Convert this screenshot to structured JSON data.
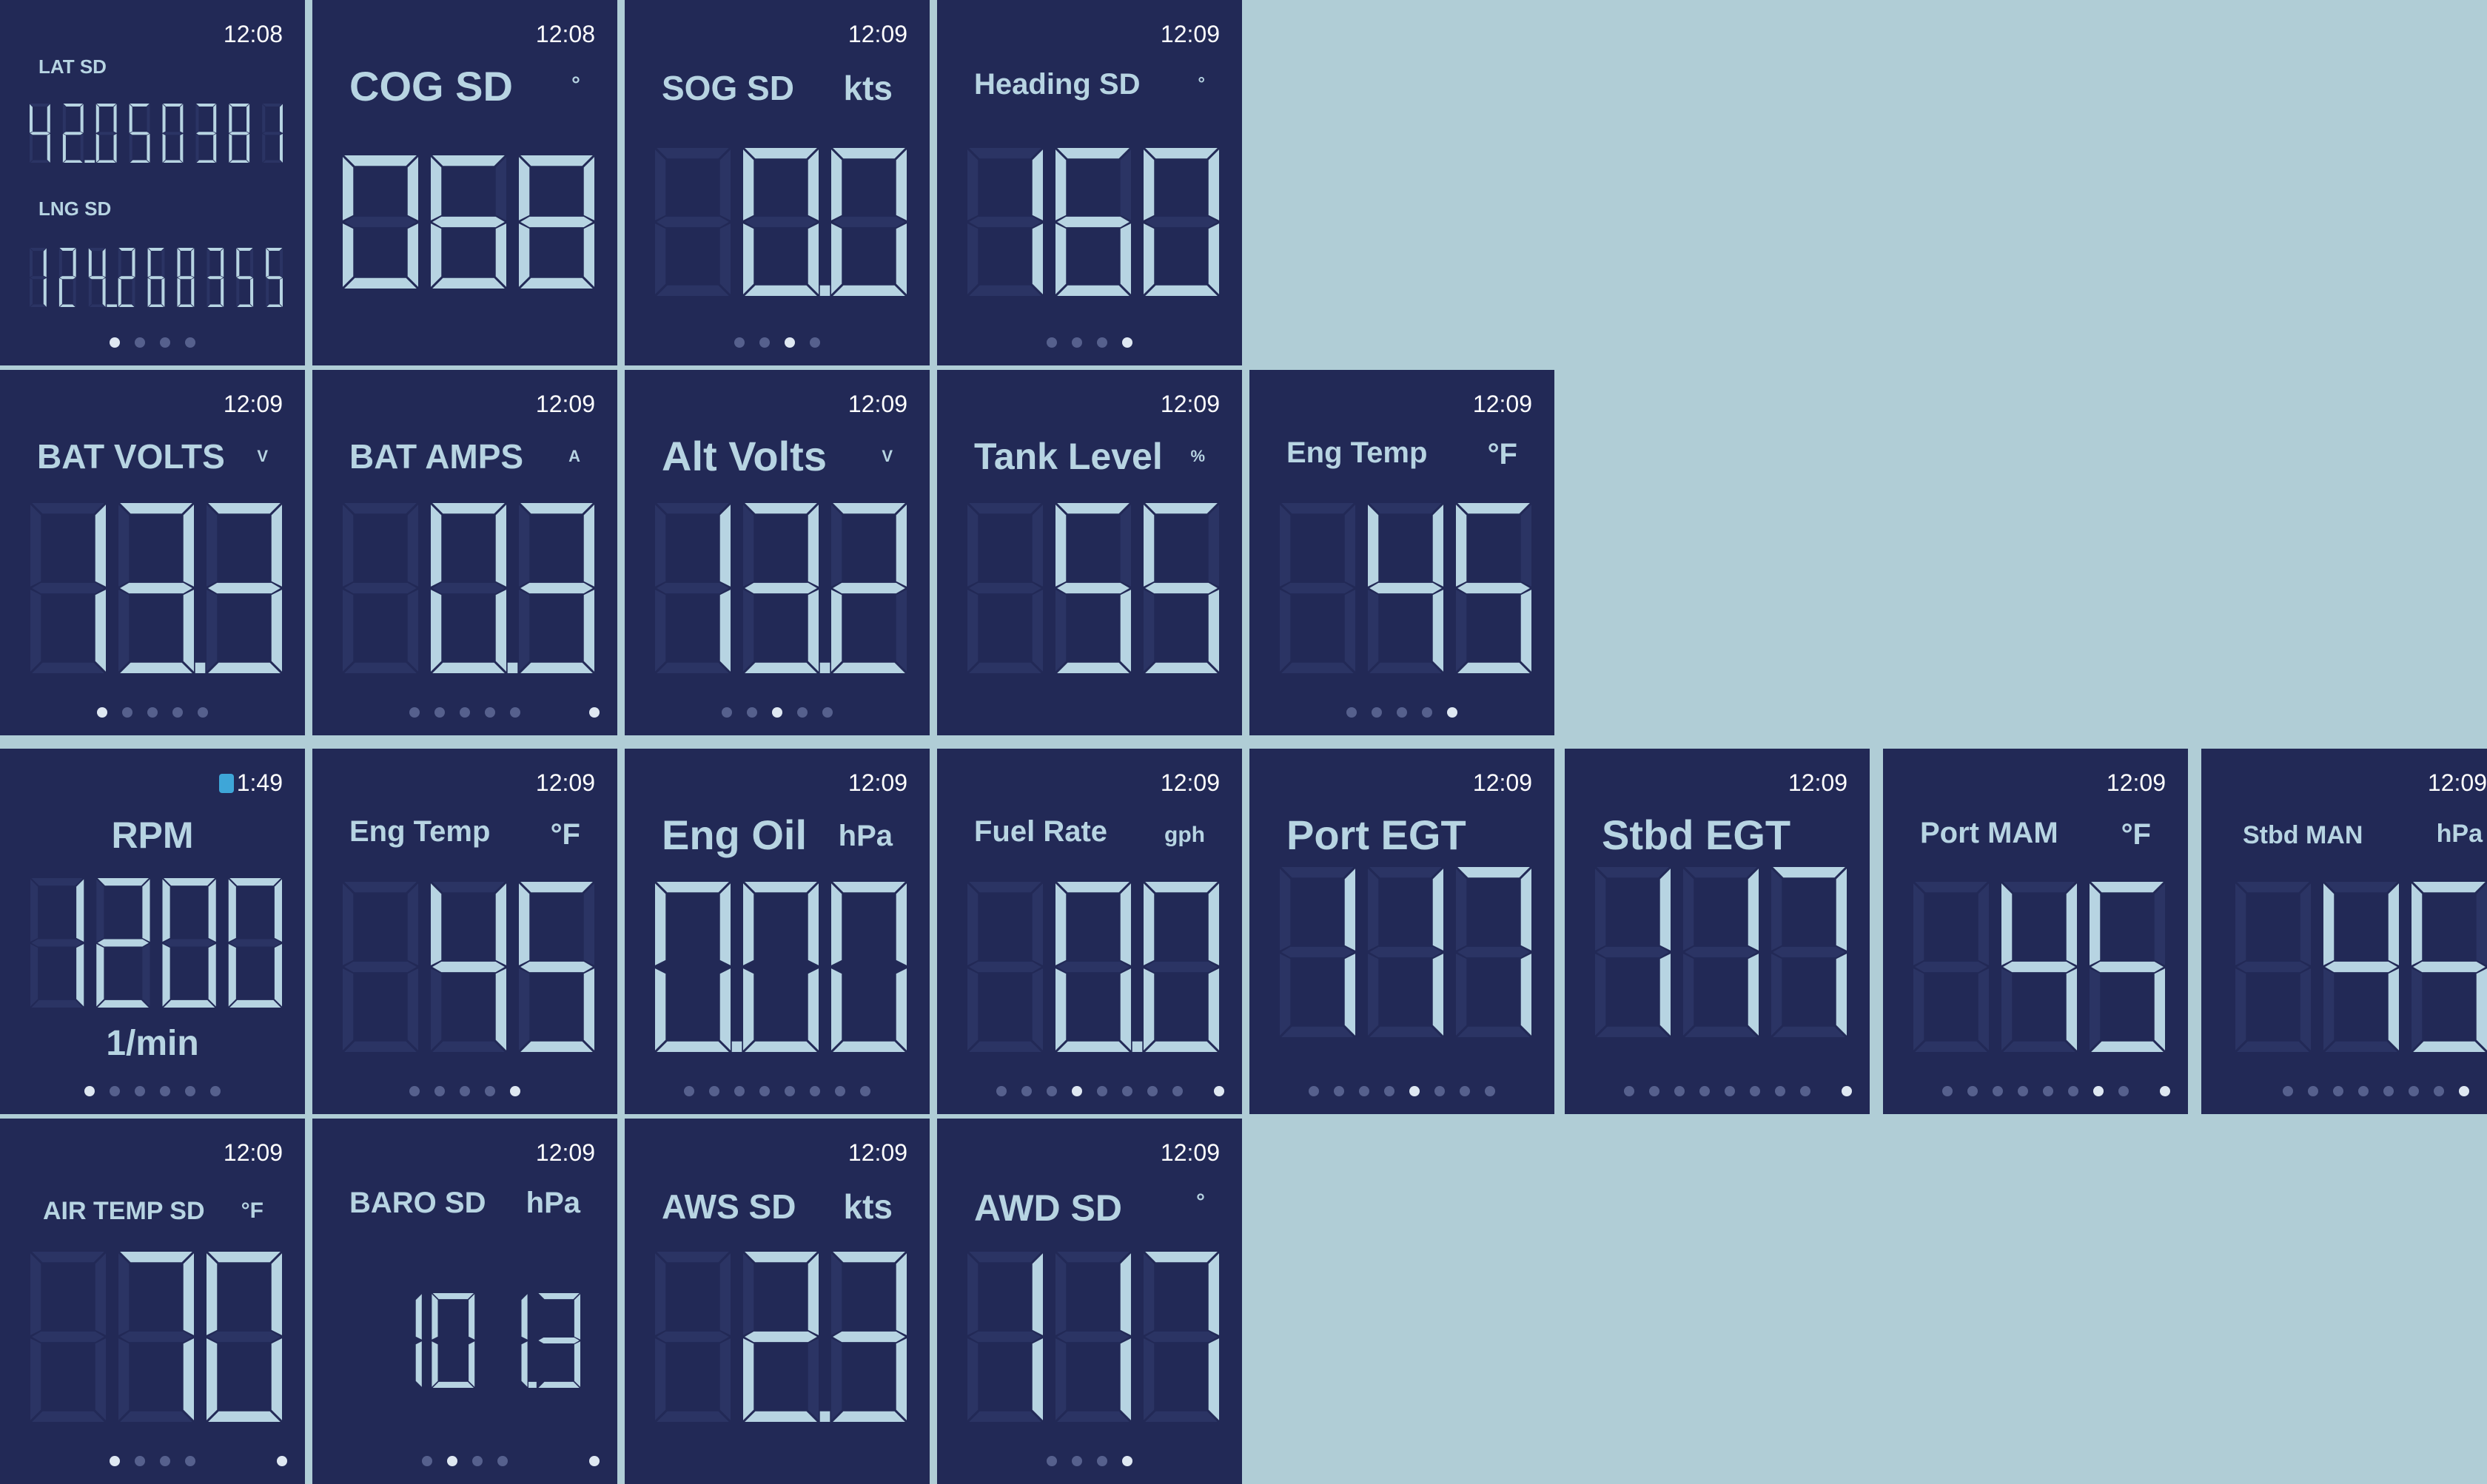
{
  "colors": {
    "background": "#b0cdd6",
    "tile": "#222956",
    "text": "#b7d4e2",
    "dim_segment": "#2b3464",
    "dot_on": "#dfe8f2",
    "dot_off": "#56608d",
    "lock": "#3ea6d8"
  },
  "tiles": [
    {
      "key": "position",
      "time": "12:08",
      "lat_label": "LAT SD",
      "lat_value": "42.0503811",
      "lat_display": "42.050381",
      "lng_label": "LNG SD",
      "lng_value": "124.268355",
      "dots": 4,
      "active_dot": 0
    },
    {
      "key": "cog",
      "time": "12:08",
      "title": "COG SD",
      "unit": "°",
      "value": "068",
      "dots": 0,
      "active_dot": -1
    },
    {
      "key": "sog",
      "time": "12:09",
      "title": "SOG SD",
      "unit": "kts",
      "value": "0.0",
      "dots": 4,
      "active_dot": 2
    },
    {
      "key": "heading",
      "time": "12:09",
      "title": "Heading SD",
      "unit": "°",
      "value": "160",
      "dots": 4,
      "active_dot": 3
    },
    {
      "key": "bat_volts",
      "time": "12:09",
      "title": "BAT VOLTS",
      "unit": "V",
      "value": "13.3",
      "dots": 5,
      "active_dot": 0
    },
    {
      "key": "bat_amps",
      "time": "12:09",
      "title": "BAT AMPS",
      "unit": "A",
      "value": "0.3",
      "dots": 5,
      "active_dot": -1,
      "end_dot": true
    },
    {
      "key": "alt_volts",
      "time": "12:09",
      "title": "Alt Volts",
      "unit": "V",
      "value": "13.2",
      "dots": 5,
      "active_dot": 2
    },
    {
      "key": "tank_level",
      "time": "12:09",
      "title": "Tank Level",
      "unit": "%",
      "value": "55",
      "dots": 0,
      "active_dot": -1
    },
    {
      "key": "eng_temp_1",
      "time": "12:09",
      "title": "Eng Temp",
      "unit": "°F",
      "value": "45",
      "dots": 5,
      "active_dot": 4
    },
    {
      "key": "rpm",
      "time": "1:49",
      "title": "RPM",
      "unit": "",
      "value": "1200",
      "bottom_label": "1/min",
      "dots": 6,
      "active_dot": 0
    },
    {
      "key": "eng_temp_2",
      "time": "12:09",
      "title": "Eng Temp",
      "unit": "°F",
      "value": "45",
      "dots": 5,
      "active_dot": 4
    },
    {
      "key": "eng_oil",
      "time": "12:09",
      "title": "Eng Oil",
      "unit": "hPa",
      "value": "0.00",
      "dots": 8,
      "active_dot": -1
    },
    {
      "key": "fuel_rate",
      "time": "12:09",
      "title": "Fuel Rate",
      "unit": "gph",
      "value": "0.0",
      "dots": 8,
      "active_dot": 3,
      "end_dot": true
    },
    {
      "key": "port_egt",
      "time": "12:09",
      "title": "Port EGT",
      "unit": "",
      "value": "117",
      "dots": 8,
      "active_dot": 4
    },
    {
      "key": "stbd_egt",
      "time": "12:09",
      "title": "Stbd EGT",
      "unit": "",
      "value": "117",
      "dots": 8,
      "active_dot": -1,
      "end_dot": true
    },
    {
      "key": "port_mam",
      "time": "12:09",
      "title": "Port MAM",
      "unit": "°F",
      "value": "45",
      "dots": 8,
      "active_dot": 6,
      "end_dot": true
    },
    {
      "key": "stbd_man",
      "time": "12:09",
      "title": "Stbd MAN",
      "unit": "hPa",
      "value": "45",
      "dots": 8,
      "active_dot": 7
    },
    {
      "key": "air_temp",
      "time": "12:09",
      "title": "AIR TEMP SD",
      "unit": "°F",
      "value": "70",
      "dots": 4,
      "active_dot": 0,
      "end_dot": true
    },
    {
      "key": "baro",
      "time": "12:09",
      "title": "BARO SD",
      "unit": "hPa",
      "value": "1013",
      "dots": 4,
      "active_dot": 1,
      "end_dot": true
    },
    {
      "key": "aws",
      "time": "12:09",
      "title": "AWS SD",
      "unit": "kts",
      "value": "2.3",
      "dots": 0,
      "active_dot": -1
    },
    {
      "key": "awd",
      "time": "12:09",
      "title": "AWD SD",
      "unit": "°",
      "value": "117",
      "dots": 4,
      "active_dot": 3
    }
  ]
}
